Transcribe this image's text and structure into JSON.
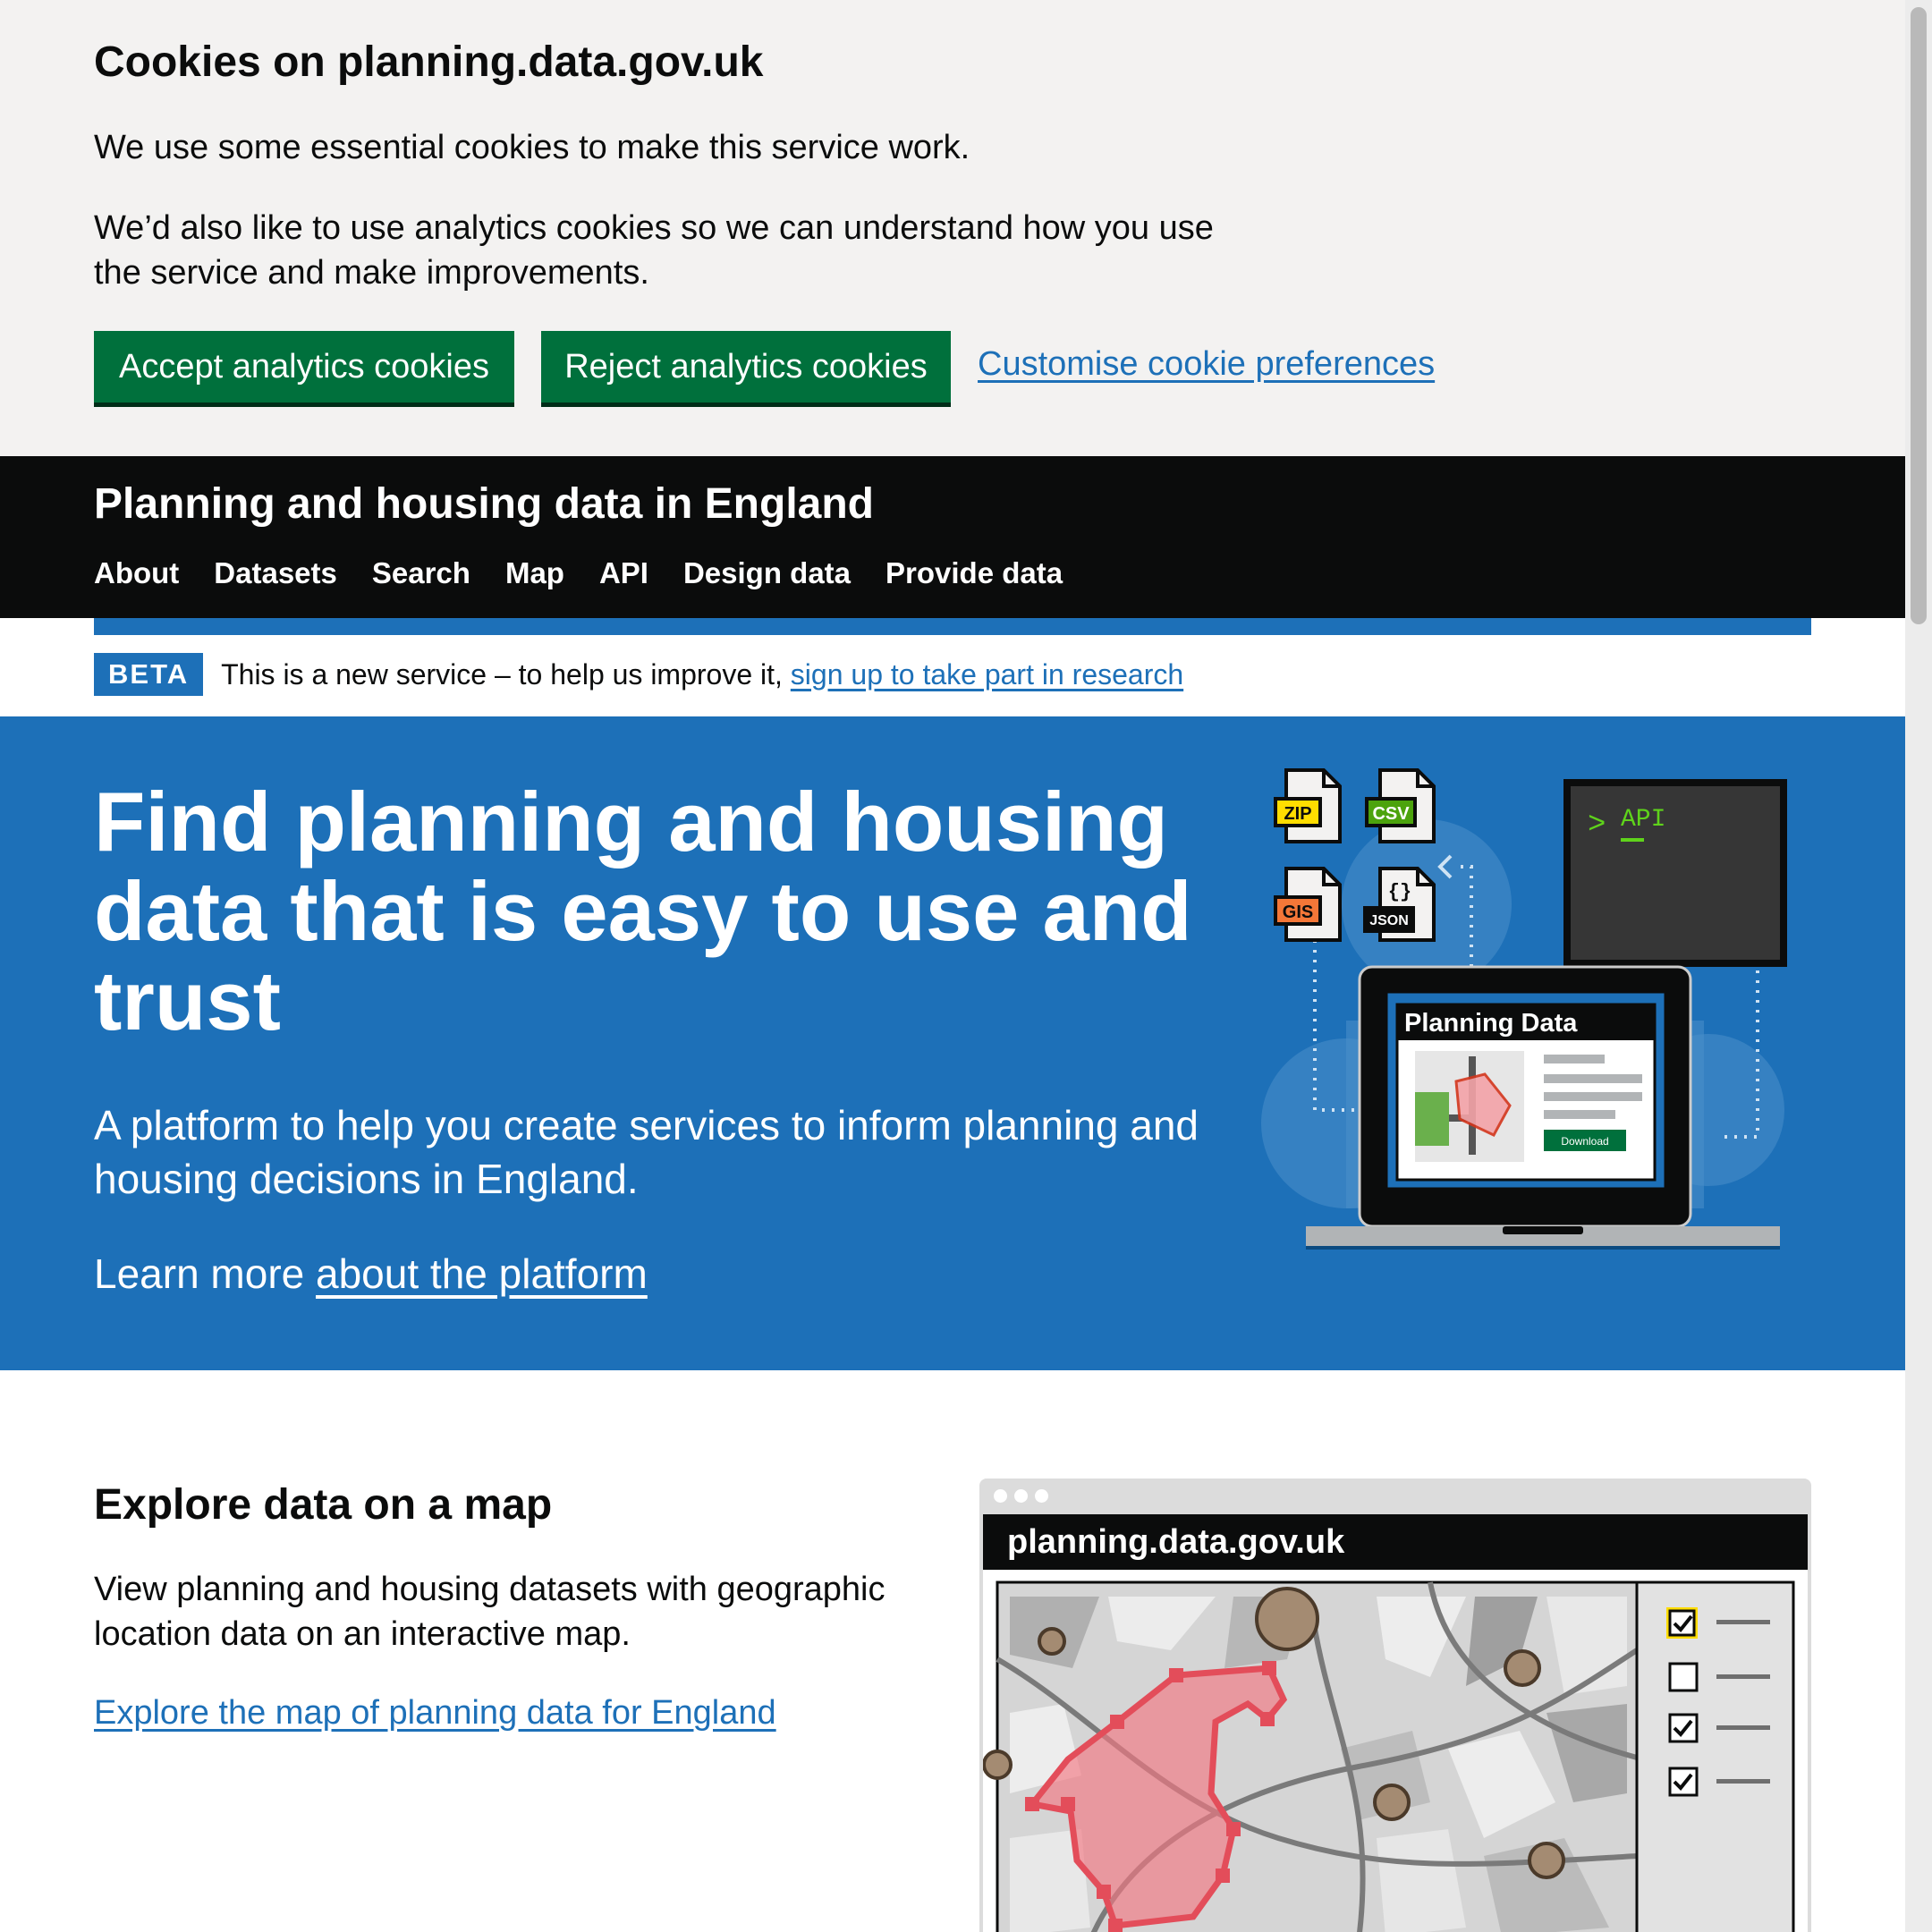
{
  "cookie_banner": {
    "heading": "Cookies on planning.data.gov.uk",
    "para1": "We use some essential cookies to make this service work.",
    "para2": "We’d also like to use analytics cookies so we can understand how you use the service and make improvements.",
    "accept_label": "Accept analytics cookies",
    "reject_label": "Reject analytics cookies",
    "customise_label": "Customise cookie preferences"
  },
  "header": {
    "title": "Planning and housing data in England",
    "nav": [
      "About",
      "Datasets",
      "Search",
      "Map",
      "API",
      "Design data",
      "Provide data"
    ]
  },
  "beta": {
    "tag": "BETA",
    "text": "This is a new service – to help us improve it,",
    "link": "sign up to take part in research"
  },
  "hero": {
    "heading": "Find planning and housing data that is easy to use and trust",
    "lead": "A platform to help you create services to inform planning and housing decisions in England.",
    "learn_prefix": "Learn more",
    "learn_link": "about the platform",
    "illustration": {
      "file_labels": [
        "ZIP",
        "CSV",
        "GIS",
        "JSON"
      ],
      "json_symbol": "{}",
      "terminal_prompt": ">",
      "terminal_text": "API",
      "laptop_title": "Planning Data",
      "download_label": "Download"
    }
  },
  "explore": {
    "heading": "Explore data on a map",
    "body": "View planning and housing datasets with geographic location data on an interactive map.",
    "link": "Explore the map of planning data for England",
    "browser_url": "planning.data.gov.uk",
    "layer_checkboxes": [
      true,
      false,
      true,
      true
    ]
  },
  "colors": {
    "govuk_blue": "#1d70b8",
    "govuk_green": "#00703c",
    "black": "#0b0c0c",
    "grey_bg": "#f3f2f1"
  }
}
